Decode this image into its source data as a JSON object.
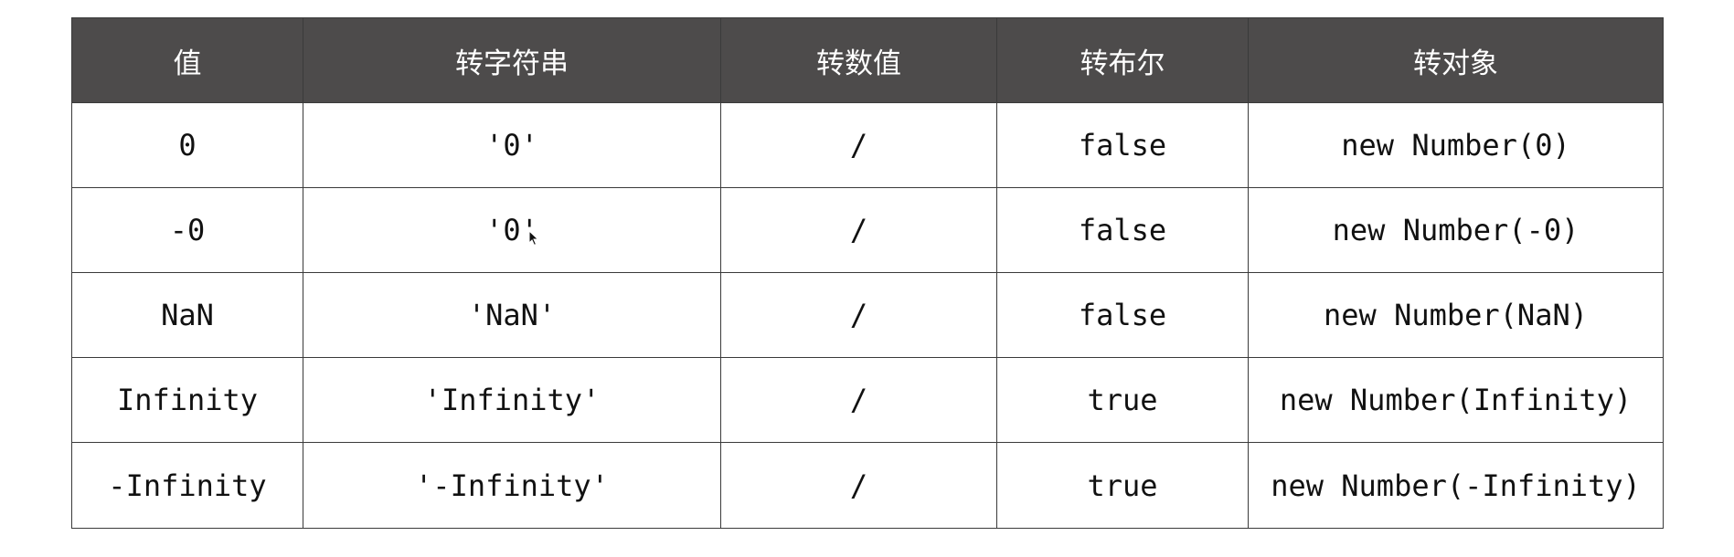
{
  "table": {
    "headers": [
      "值",
      "转字符串",
      "转数值",
      "转布尔",
      "转对象"
    ],
    "rows": [
      [
        "0",
        "'0'",
        "/",
        "false",
        "new Number(0)"
      ],
      [
        "-0",
        "'0'",
        "/",
        "false",
        "new Number(-0)"
      ],
      [
        "NaN",
        "'NaN'",
        "/",
        "false",
        "new Number(NaN)"
      ],
      [
        "Infinity",
        "'Infinity'",
        "/",
        "true",
        "new Number(Infinity)"
      ],
      [
        "-Infinity",
        "'-Infinity'",
        "/",
        "true",
        "new Number(-Infinity)"
      ]
    ]
  },
  "colors": {
    "header_background": "#4d4b4b",
    "header_text": "#ffffff",
    "border": "#3a3a3a",
    "cell_text": "#111111"
  },
  "icons": {
    "cursor": "mouse-pointer-icon"
  }
}
